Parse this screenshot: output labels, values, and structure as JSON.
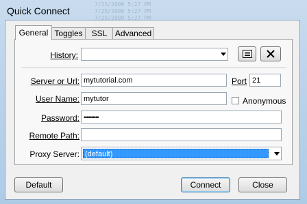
{
  "window": {
    "title": "Quick Connect"
  },
  "tabs": [
    {
      "label": "General"
    },
    {
      "label": "Toggles"
    },
    {
      "label": "SSL"
    },
    {
      "label": "Advanced"
    }
  ],
  "form": {
    "history_label": "History:",
    "server_label": "Server or Url:",
    "server_value": "mytutorial.com",
    "port_label": "Port",
    "port_value": "21",
    "username_label": "User Name:",
    "username_value": "mytutor",
    "anonymous_label": "Anonymous",
    "password_label": "Password:",
    "password_value": "••••••••••",
    "remote_path_label": "Remote Path:",
    "remote_path_value": "",
    "proxy_label": "Proxy Server:",
    "proxy_value": "(default)"
  },
  "buttons": {
    "default": "Default",
    "connect": "Connect",
    "close": "Close"
  }
}
